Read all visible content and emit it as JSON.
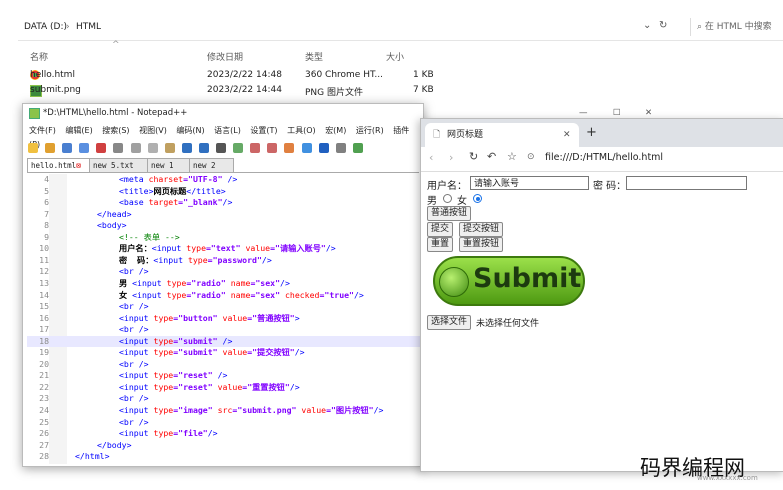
{
  "explorer": {
    "path": [
      "DATA (D:)",
      "HTML"
    ],
    "search_placeholder": "在 HTML 中搜索",
    "columns": [
      "名称",
      "修改日期",
      "类型",
      "大小"
    ],
    "files": [
      {
        "name": "hello.html",
        "date": "2023/2/22 14:48",
        "type": "360 Chrome HT...",
        "size": "1 KB"
      },
      {
        "name": "submit.png",
        "date": "2023/2/22 14:44",
        "type": "PNG 图片文件",
        "size": "7 KB"
      }
    ]
  },
  "notepad": {
    "title": "*D:\\HTML\\hello.html - Notepad++",
    "menu": [
      "文件(F)",
      "编辑(E)",
      "搜索(S)",
      "视图(V)",
      "编码(N)",
      "语言(L)",
      "设置(T)",
      "工具(O)",
      "宏(M)",
      "运行(R)",
      "插件(P)"
    ],
    "tabs": [
      "hello.html",
      "new 5.txt",
      "new 1",
      "new 2"
    ],
    "lines": [
      {
        "n": "4",
        "parts": [
          {
            "t": "<meta ",
            "c": "tg"
          },
          {
            "t": "charset",
            "c": "at"
          },
          {
            "t": "=\"UTF-8\" ",
            "c": "vl"
          },
          {
            "t": "/>",
            "c": "tg"
          }
        ],
        "indent": 2
      },
      {
        "n": "5",
        "parts": [
          {
            "t": "<title>",
            "c": "tg"
          },
          {
            "t": "网页标题",
            "c": "tx"
          },
          {
            "t": "</title>",
            "c": "tg"
          }
        ],
        "indent": 2
      },
      {
        "n": "6",
        "parts": [
          {
            "t": "<base ",
            "c": "tg"
          },
          {
            "t": "target",
            "c": "at"
          },
          {
            "t": "=\"_blank\"",
            "c": "vl"
          },
          {
            "t": "/>",
            "c": "tg"
          }
        ],
        "indent": 2
      },
      {
        "n": "7",
        "parts": [
          {
            "t": "</head>",
            "c": "tg"
          }
        ],
        "indent": 1
      },
      {
        "n": "8",
        "parts": [
          {
            "t": "<body>",
            "c": "tg"
          }
        ],
        "indent": 1
      },
      {
        "n": "9",
        "parts": [
          {
            "t": "<!-- 表单 -->",
            "c": "cm"
          }
        ],
        "indent": 2
      },
      {
        "n": "10",
        "parts": [
          {
            "t": "用户名：",
            "c": "tx"
          },
          {
            "t": "<input ",
            "c": "tg"
          },
          {
            "t": "type",
            "c": "at"
          },
          {
            "t": "=\"text\" ",
            "c": "vl"
          },
          {
            "t": "value",
            "c": "at"
          },
          {
            "t": "=\"请输入账号\"",
            "c": "vl"
          },
          {
            "t": "/>",
            "c": "tg"
          }
        ],
        "indent": 2
      },
      {
        "n": "11",
        "parts": [
          {
            "t": "密  码：",
            "c": "tx"
          },
          {
            "t": "<input ",
            "c": "tg"
          },
          {
            "t": "type",
            "c": "at"
          },
          {
            "t": "=\"password\"",
            "c": "vl"
          },
          {
            "t": "/>",
            "c": "tg"
          }
        ],
        "indent": 2
      },
      {
        "n": "12",
        "parts": [
          {
            "t": "<br />",
            "c": "tg"
          }
        ],
        "indent": 2
      },
      {
        "n": "13",
        "parts": [
          {
            "t": "男 ",
            "c": "tx"
          },
          {
            "t": "<input ",
            "c": "tg"
          },
          {
            "t": "type",
            "c": "at"
          },
          {
            "t": "=\"radio\" ",
            "c": "vl"
          },
          {
            "t": "name",
            "c": "at"
          },
          {
            "t": "=\"sex\"",
            "c": "vl"
          },
          {
            "t": "/>",
            "c": "tg"
          }
        ],
        "indent": 2
      },
      {
        "n": "14",
        "parts": [
          {
            "t": "女 ",
            "c": "tx"
          },
          {
            "t": "<input ",
            "c": "tg"
          },
          {
            "t": "type",
            "c": "at"
          },
          {
            "t": "=\"radio\" ",
            "c": "vl"
          },
          {
            "t": "name",
            "c": "at"
          },
          {
            "t": "=\"sex\" ",
            "c": "vl"
          },
          {
            "t": "checked",
            "c": "at"
          },
          {
            "t": "=\"true\"",
            "c": "vl"
          },
          {
            "t": "/>",
            "c": "tg"
          }
        ],
        "indent": 2
      },
      {
        "n": "15",
        "parts": [
          {
            "t": "<br />",
            "c": "tg"
          }
        ],
        "indent": 2
      },
      {
        "n": "16",
        "parts": [
          {
            "t": "<input ",
            "c": "tg"
          },
          {
            "t": "type",
            "c": "at"
          },
          {
            "t": "=\"button\" ",
            "c": "vl"
          },
          {
            "t": "value",
            "c": "at"
          },
          {
            "t": "=\"普通按钮\"",
            "c": "vl"
          },
          {
            "t": ">",
            "c": "tg"
          }
        ],
        "indent": 2
      },
      {
        "n": "17",
        "parts": [
          {
            "t": "<br />",
            "c": "tg"
          }
        ],
        "indent": 2
      },
      {
        "n": "18",
        "parts": [
          {
            "t": "<input ",
            "c": "tg"
          },
          {
            "t": "type",
            "c": "at"
          },
          {
            "t": "=\"submit\" ",
            "c": "vl"
          },
          {
            "t": "/>",
            "c": "tg"
          }
        ],
        "indent": 2,
        "hl": true
      },
      {
        "n": "19",
        "parts": [
          {
            "t": "<input ",
            "c": "tg"
          },
          {
            "t": "type",
            "c": "at"
          },
          {
            "t": "=\"submit\" ",
            "c": "vl"
          },
          {
            "t": "value",
            "c": "at"
          },
          {
            "t": "=\"提交按钮\"",
            "c": "vl"
          },
          {
            "t": "/>",
            "c": "tg"
          }
        ],
        "indent": 2
      },
      {
        "n": "20",
        "parts": [
          {
            "t": "<br />",
            "c": "tg"
          }
        ],
        "indent": 2
      },
      {
        "n": "21",
        "parts": [
          {
            "t": "<input ",
            "c": "tg"
          },
          {
            "t": "type",
            "c": "at"
          },
          {
            "t": "=\"reset\" ",
            "c": "vl"
          },
          {
            "t": "/>",
            "c": "tg"
          }
        ],
        "indent": 2
      },
      {
        "n": "22",
        "parts": [
          {
            "t": "<input ",
            "c": "tg"
          },
          {
            "t": "type",
            "c": "at"
          },
          {
            "t": "=\"reset\" ",
            "c": "vl"
          },
          {
            "t": "value",
            "c": "at"
          },
          {
            "t": "=\"重置按钮\"",
            "c": "vl"
          },
          {
            "t": "/>",
            "c": "tg"
          }
        ],
        "indent": 2
      },
      {
        "n": "23",
        "parts": [
          {
            "t": "<br />",
            "c": "tg"
          }
        ],
        "indent": 2
      },
      {
        "n": "24",
        "parts": [
          {
            "t": "<input ",
            "c": "tg"
          },
          {
            "t": "type",
            "c": "at"
          },
          {
            "t": "=\"image\" ",
            "c": "vl"
          },
          {
            "t": "src",
            "c": "at"
          },
          {
            "t": "=\"submit.png\" ",
            "c": "vl"
          },
          {
            "t": "value",
            "c": "at"
          },
          {
            "t": "=\"图片按钮\"",
            "c": "vl"
          },
          {
            "t": "/>",
            "c": "tg"
          }
        ],
        "indent": 2
      },
      {
        "n": "25",
        "parts": [
          {
            "t": "<br />",
            "c": "tg"
          }
        ],
        "indent": 2
      },
      {
        "n": "26",
        "parts": [
          {
            "t": "<input ",
            "c": "tg"
          },
          {
            "t": "type",
            "c": "at"
          },
          {
            "t": "=\"file\"",
            "c": "vl"
          },
          {
            "t": "/>",
            "c": "tg"
          }
        ],
        "indent": 2
      },
      {
        "n": "27",
        "parts": [
          {
            "t": "</body>",
            "c": "tg"
          }
        ],
        "indent": 1
      },
      {
        "n": "28",
        "parts": [
          {
            "t": "</html>",
            "c": "tg"
          }
        ],
        "indent": 0
      }
    ]
  },
  "browser": {
    "tab_title": "网页标题",
    "url": "file:///D:/HTML/hello.html",
    "form": {
      "username_label": "用户名：",
      "username_value": "请输入账号",
      "password_label": "密 码：",
      "male_label": "男",
      "female_label": "女",
      "button_normal": "普通按钮",
      "button_submit": "提交",
      "button_submit2": "提交按钮",
      "button_reset": "重置",
      "button_reset2": "重置按钮",
      "image_button_text": "Submit",
      "file_button": "选择文件",
      "file_status": "未选择任何文件"
    }
  },
  "watermark": {
    "text": "码界编程网",
    "sub": "www.xxxxxx.com"
  },
  "colors": {
    "tag": "#0000ff",
    "attr": "#ff0000",
    "value": "#8000ff",
    "comment": "#008000",
    "submit_green": "#6fbf1f"
  }
}
